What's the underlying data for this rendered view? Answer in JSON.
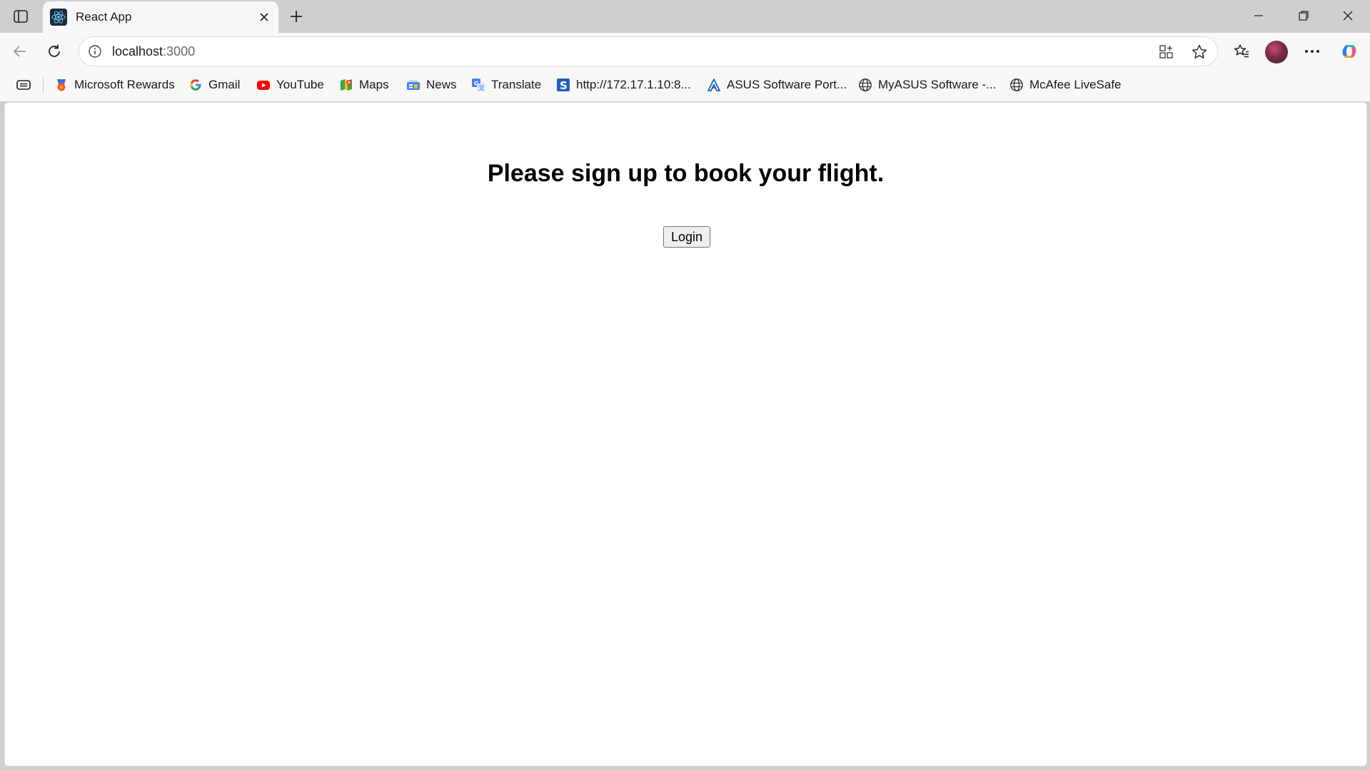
{
  "browser": {
    "tab": {
      "title": "React App"
    },
    "address": {
      "host": "localhost",
      "port": ":3000"
    },
    "bookmarks": [
      {
        "label": "Microsoft Rewards",
        "icon": "rewards-icon"
      },
      {
        "label": "Gmail",
        "icon": "google-icon"
      },
      {
        "label": "YouTube",
        "icon": "youtube-icon"
      },
      {
        "label": "Maps",
        "icon": "maps-icon"
      },
      {
        "label": "News",
        "icon": "news-icon"
      },
      {
        "label": "Translate",
        "icon": "translate-icon"
      },
      {
        "label": "http://172.17.1.10:8...",
        "icon": "s-icon"
      },
      {
        "label": "ASUS Software Port...",
        "icon": "asus-icon"
      },
      {
        "label": "MyASUS Software -...",
        "icon": "globe-icon"
      },
      {
        "label": "McAfee LiveSafe",
        "icon": "globe-icon"
      }
    ]
  },
  "page": {
    "heading": "Please sign up to book your flight.",
    "login_label": "Login"
  }
}
